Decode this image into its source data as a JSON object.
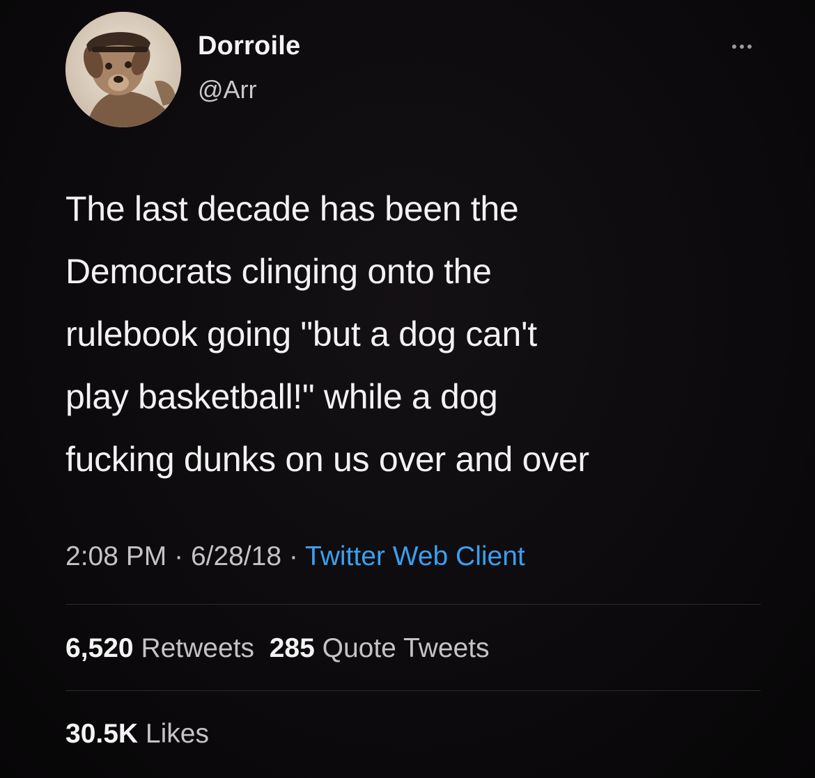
{
  "user": {
    "display_name": "Dorroile",
    "handle": "@Arr",
    "avatar_icon": "dog-avatar-icon"
  },
  "more_icon": "more-dots-icon",
  "tweet": {
    "lines": [
      "The last decade has been the",
      "Democrats clinging onto the",
      "rulebook going \"but a dog can't",
      "play basketball!\" while a dog",
      "fucking dunks on us over and over"
    ]
  },
  "meta": {
    "time": "2:08 PM",
    "separator": "·",
    "date": "6/28/18",
    "client": "Twitter Web Client"
  },
  "stats": {
    "retweets_count": "6,520",
    "retweets_label": "Retweets",
    "quotes_count": "285",
    "quotes_label": "Quote Tweets",
    "likes_count": "30.5K",
    "likes_label": "Likes"
  },
  "colors": {
    "background": "#0b090b",
    "link": "#3aa0f0",
    "text": "#f2f2f2",
    "secondary": "#c4c4c4"
  }
}
